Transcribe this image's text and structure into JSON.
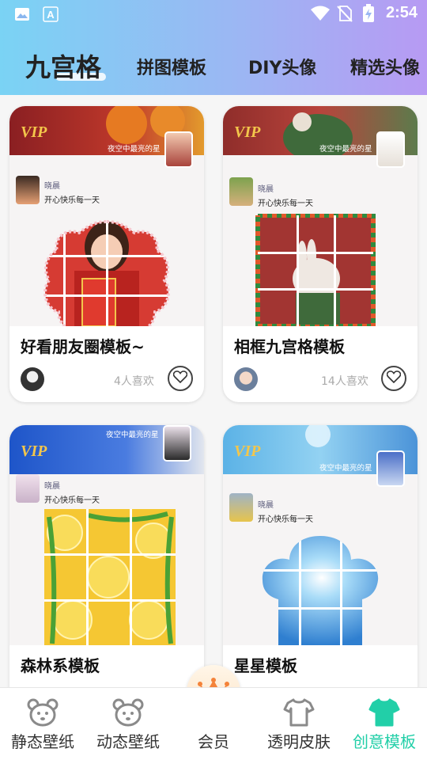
{
  "status_bar": {
    "time": "2:54",
    "icons": [
      "image-icon",
      "text-a-icon",
      "wifi-icon",
      "no-sim-icon",
      "battery-charging-icon"
    ]
  },
  "tabs": [
    {
      "label": "九宫格",
      "active": true
    },
    {
      "label": "拼图模板",
      "active": false
    },
    {
      "label": "DIY头像",
      "active": false
    },
    {
      "label": "精选头像",
      "active": false
    }
  ],
  "cards": [
    {
      "title": "好看朋友圈模板~",
      "likes": "4人喜欢",
      "vip_badge": "VIP",
      "banner_text": "夜空中最亮的星",
      "user_name": "晓晨",
      "user_sign": "开心快乐每一天"
    },
    {
      "title": "相框九宫格模板",
      "likes": "14人喜欢",
      "vip_badge": "VIP",
      "banner_text": "夜空中最亮的星",
      "user_name": "晓晨",
      "user_sign": "开心快乐每一天"
    },
    {
      "title": "森林系模板",
      "likes": "",
      "vip_badge": "VIP",
      "banner_text": "夜空中最亮的星",
      "user_name": "晓晨",
      "user_sign": "开心快乐每一天"
    },
    {
      "title": "星星模板",
      "likes": "",
      "vip_badge": "VIP",
      "banner_text": "夜空中最亮的星",
      "user_name": "晓晨",
      "user_sign": "开心快乐每一天"
    }
  ],
  "bottom_nav": [
    {
      "label": "静态壁纸",
      "icon": "bear-icon",
      "active": false
    },
    {
      "label": "动态壁纸",
      "icon": "bear-icon",
      "active": false
    },
    {
      "label": "会员",
      "icon": "crown-icon",
      "active": false
    },
    {
      "label": "透明皮肤",
      "icon": "tshirt-outline-icon",
      "active": false
    },
    {
      "label": "创意模板",
      "icon": "tshirt-filled-icon",
      "active": true
    }
  ],
  "colors": {
    "header_start": "#7ad3f4",
    "header_end": "#b79af3",
    "active_nav": "#22cfa8",
    "vip_gold": "#f3c64b",
    "crown": "#f4833a"
  }
}
